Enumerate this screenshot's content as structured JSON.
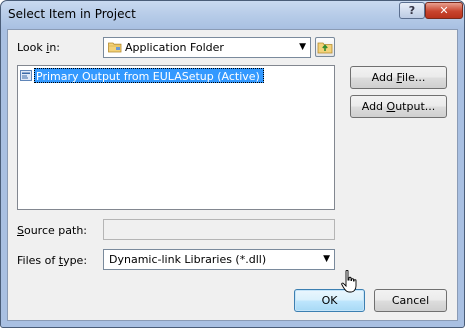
{
  "window": {
    "title": "Select Item in Project",
    "help_glyph": "?",
    "close_glyph": "✕"
  },
  "look_in": {
    "label_pre": "Look ",
    "label_key": "i",
    "label_post": "n:",
    "value": "Application Folder"
  },
  "list": {
    "items": [
      {
        "label": "Primary Output from EULASetup (Active)",
        "selected": true
      }
    ]
  },
  "buttons": {
    "add_file": {
      "pre": "Add ",
      "key": "F",
      "post": "ile..."
    },
    "add_output": {
      "pre": "Add ",
      "key": "O",
      "post": "utput..."
    },
    "ok": "OK",
    "cancel": "Cancel"
  },
  "source_path": {
    "key": "S",
    "label_post": "ource path:",
    "value": ""
  },
  "files_of_type": {
    "label_pre": "Files of ",
    "key": "t",
    "label_post": "ype:",
    "value": "Dynamic-link Libraries (*.dll)"
  },
  "icons": [
    "folder-icon",
    "folder-up-icon",
    "project-output-icon",
    "chevron-down-icon",
    "close-icon",
    "help-icon",
    "mouse-cursor-icon"
  ],
  "colors": {
    "selection": "#3399ff",
    "title_bar": "#b7cce8",
    "close_button": "#c8442e"
  }
}
